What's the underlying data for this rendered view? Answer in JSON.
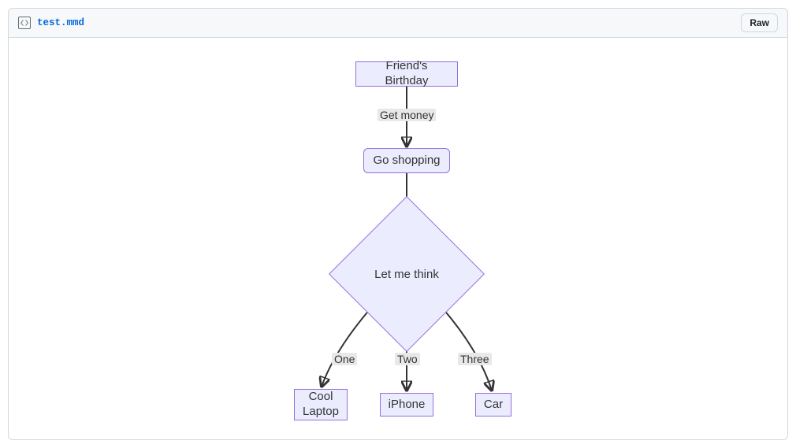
{
  "file": {
    "name": "test.mmd",
    "raw_button": "Raw"
  },
  "diagram": {
    "nodes": {
      "a": "Friend's Birthday",
      "b": "Go shopping",
      "c": "Let me think",
      "d": "Cool Laptop",
      "e": "iPhone",
      "f": "Car"
    },
    "edges": {
      "ab": "Get money",
      "cd": "One",
      "ce": "Two",
      "cf": "Three"
    }
  }
}
